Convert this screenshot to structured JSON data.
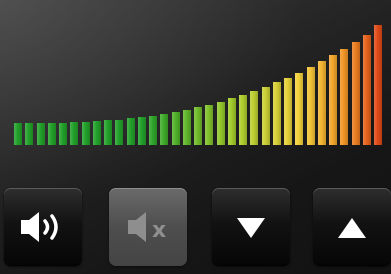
{
  "volume_meter": {
    "segments_total": 33,
    "colors": {
      "green": "#22a12a",
      "yellow_green": "#a4cc2a",
      "yellow": "#f2d23c",
      "orange": "#f29a26",
      "red": "#e04a16"
    }
  },
  "controls": {
    "volume_on": {
      "icon": "speaker-sound-icon",
      "enabled": true
    },
    "mute": {
      "icon": "speaker-mute-icon",
      "label": "x",
      "enabled": false
    },
    "volume_down": {
      "icon": "triangle-down-icon",
      "enabled": true
    },
    "volume_up": {
      "icon": "triangle-up-icon",
      "enabled": true
    }
  }
}
